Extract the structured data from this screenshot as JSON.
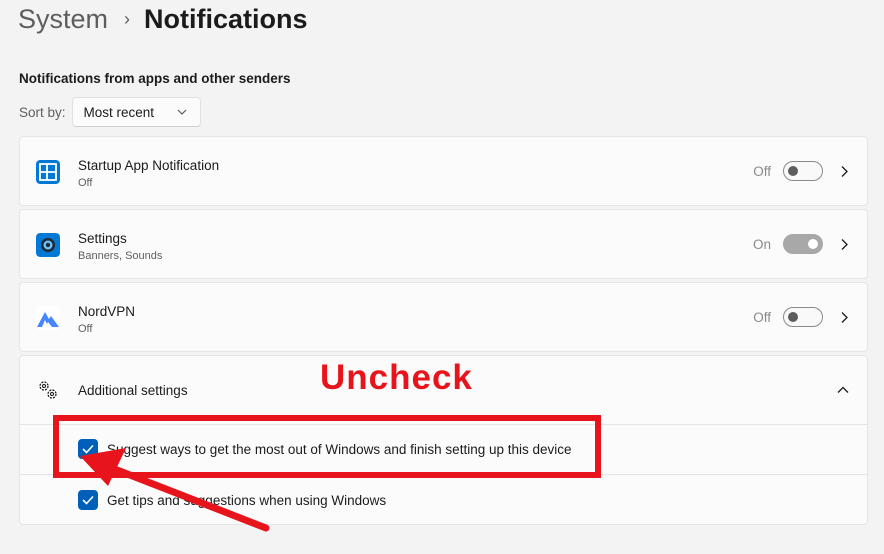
{
  "breadcrumb": {
    "parent": "System",
    "separator": "›",
    "current": "Notifications"
  },
  "section_title": "Notifications from apps and other senders",
  "sort": {
    "label": "Sort by:",
    "value": "Most recent"
  },
  "apps": [
    {
      "name": "Startup App Notification",
      "sub": "Off",
      "state": "Off",
      "enabled": false,
      "icon": "startup-app-icon",
      "icon_color": "#0078d4"
    },
    {
      "name": "Settings",
      "sub": "Banners, Sounds",
      "state": "On",
      "enabled": true,
      "icon": "settings-app-icon",
      "icon_color": "#0078d4"
    },
    {
      "name": "NordVPN",
      "sub": "Off",
      "state": "Off",
      "enabled": false,
      "icon": "nordvpn-icon",
      "icon_color": "#4687ff"
    }
  ],
  "additional": {
    "label": "Additional settings",
    "options": [
      {
        "label": "Suggest ways to get the most out of Windows and finish setting up this device",
        "checked": true
      },
      {
        "label": "Get tips and suggestions when using Windows",
        "checked": true
      }
    ]
  },
  "annotation": {
    "text": "Uncheck",
    "color": "#e8141b"
  },
  "colors": {
    "accent": "#005fb8",
    "background": "#f3f3f3",
    "card": "#fbfbfb"
  }
}
